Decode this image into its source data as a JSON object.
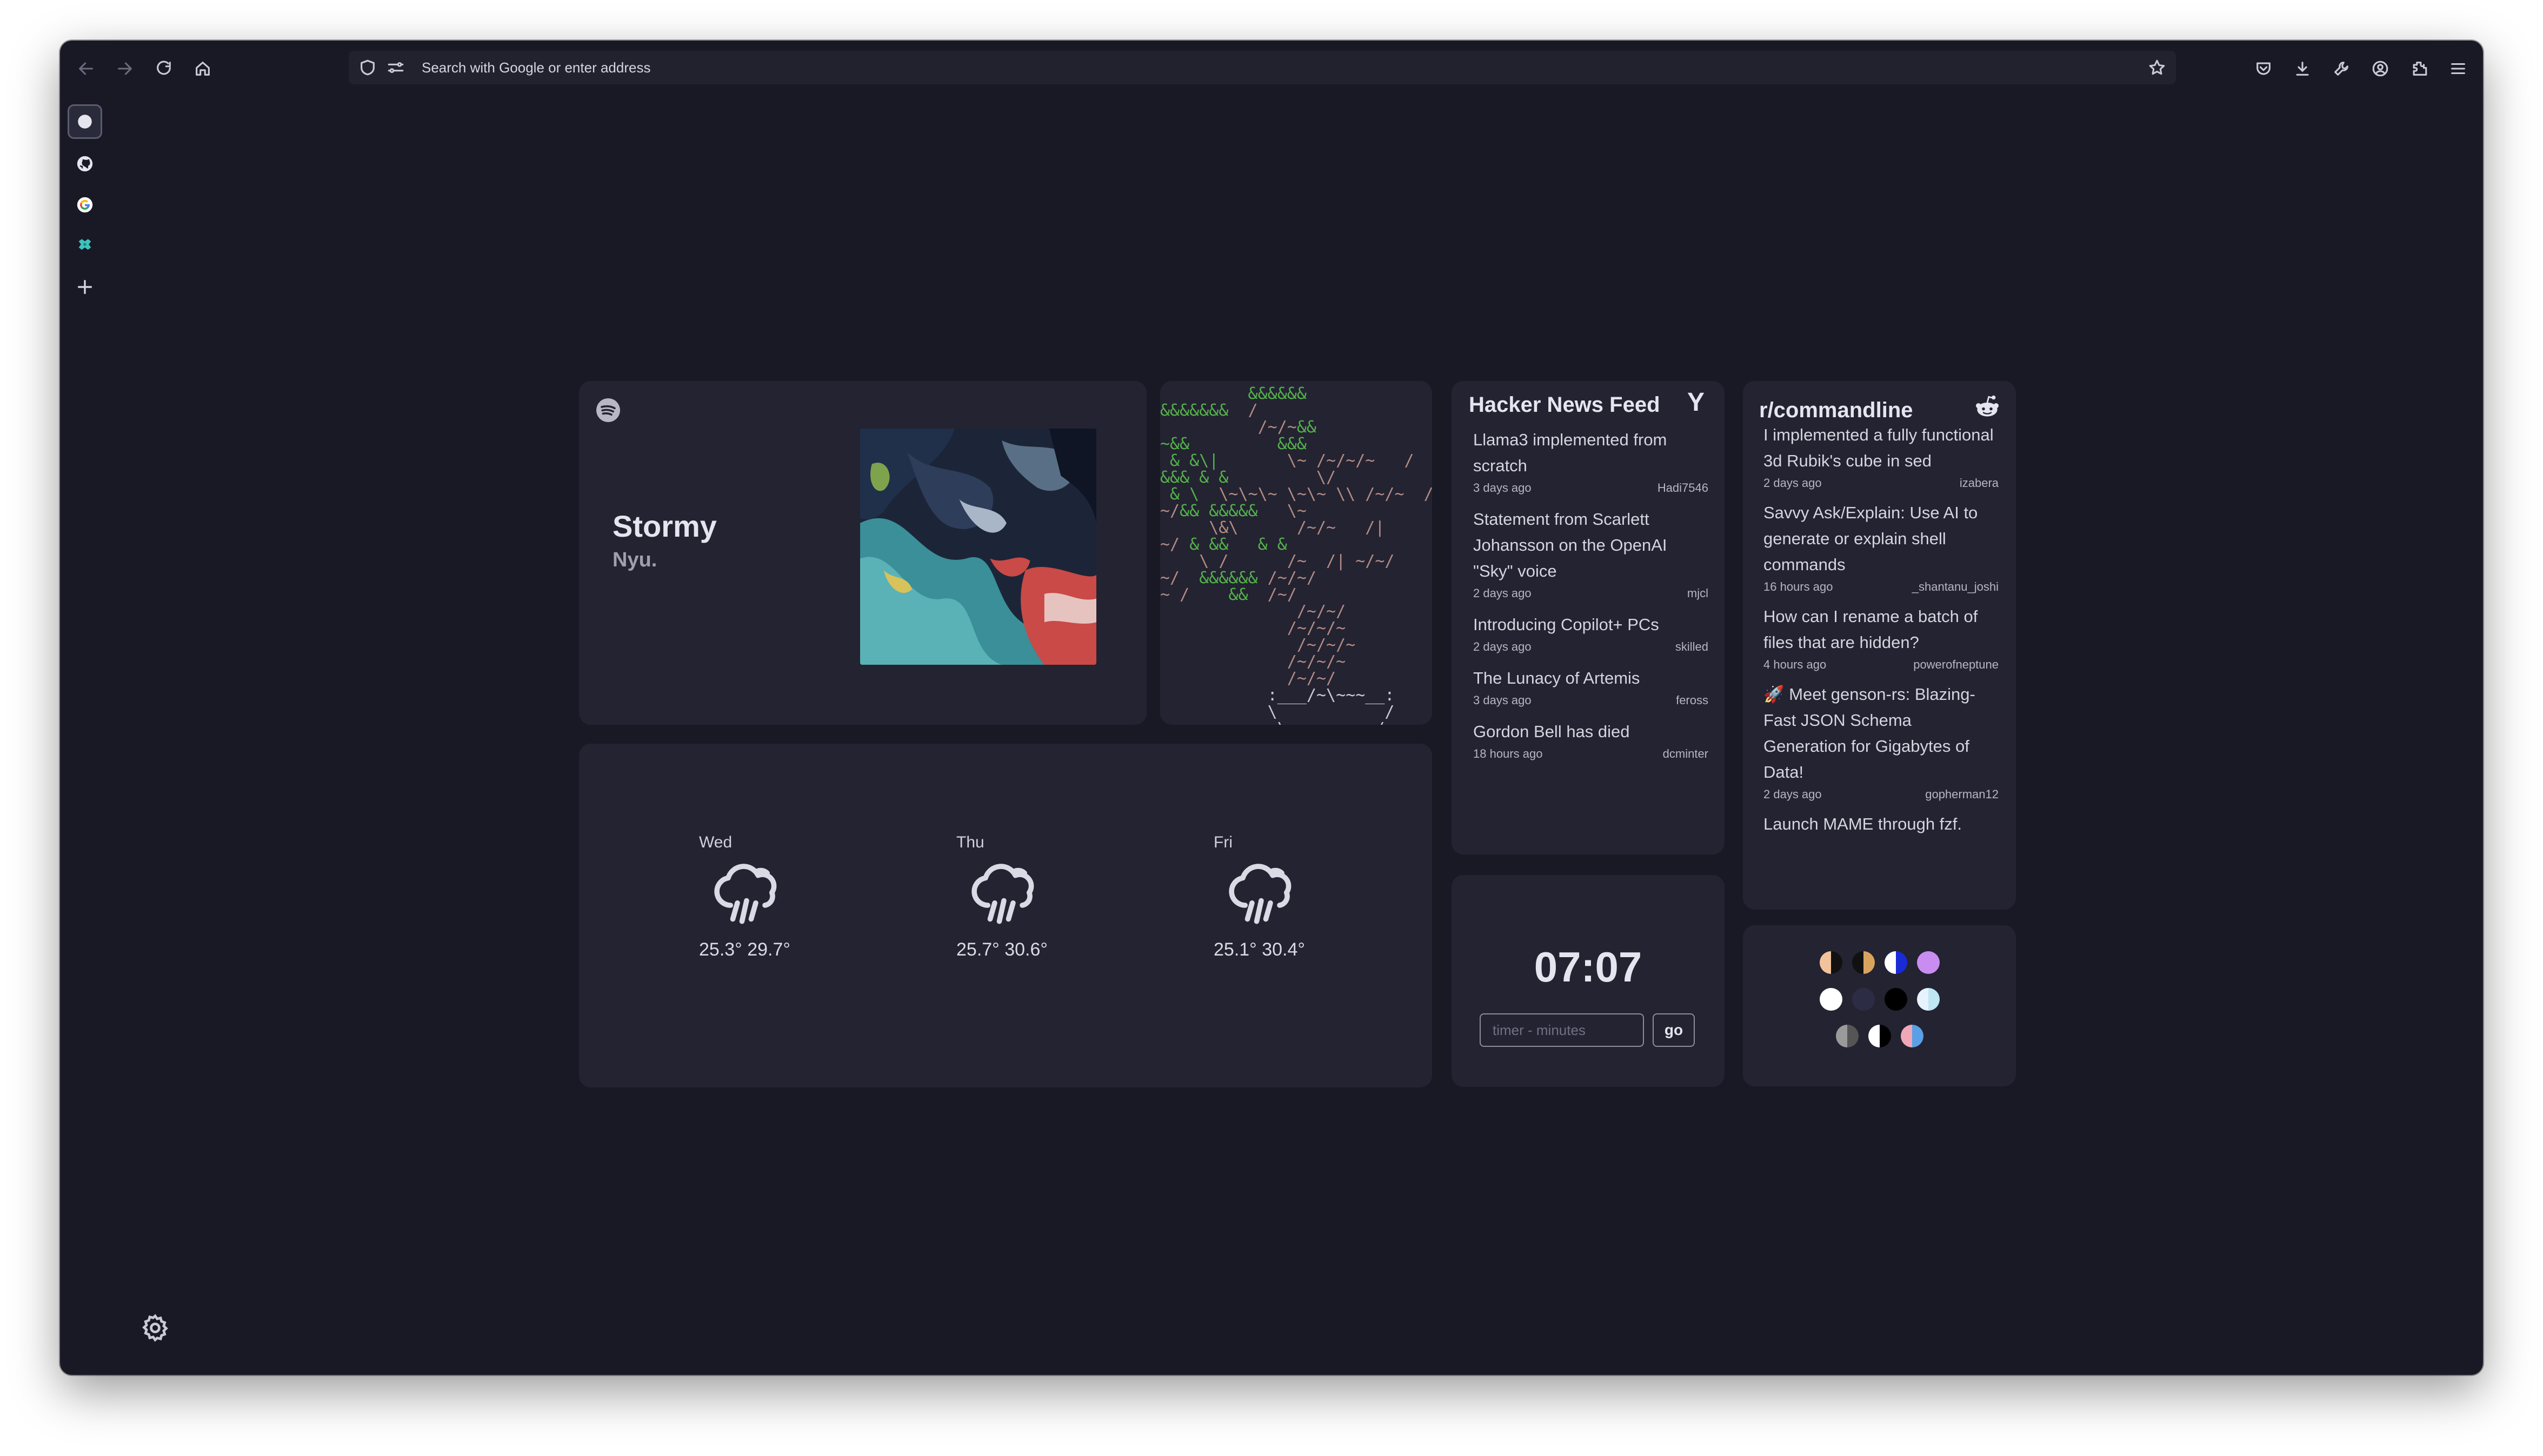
{
  "browser": {
    "url_placeholder": "Search with Google or enter address"
  },
  "sidebar": {
    "items": [
      {
        "name": "home",
        "icon": "circle-icon",
        "active": true
      },
      {
        "name": "github",
        "icon": "github-icon"
      },
      {
        "name": "google",
        "icon": "google-icon"
      },
      {
        "name": "extension",
        "icon": "puzzle-icon"
      }
    ],
    "add_icon": "plus-icon"
  },
  "spotify": {
    "title": "Stormy",
    "artist": "Nyu."
  },
  "weather": {
    "days": [
      {
        "day": "Wed",
        "low": "25.3°",
        "high": "29.7°",
        "icon": "rain-icon"
      },
      {
        "day": "Thu",
        "low": "25.7°",
        "high": "30.6°",
        "icon": "rain-icon"
      },
      {
        "day": "Fri",
        "low": "25.1°",
        "high": "30.4°",
        "icon": "rain-icon"
      }
    ]
  },
  "hacker_news": {
    "title": "Hacker News Feed",
    "logo": "Y",
    "items": [
      {
        "title": "Llama3 implemented from scratch",
        "time": "3 days ago",
        "author": "Hadi7546"
      },
      {
        "title": "Statement from Scarlett Johansson on the OpenAI \"Sky\" voice",
        "time": "2 days ago",
        "author": "mjcl"
      },
      {
        "title": "Introducing Copilot+ PCs",
        "time": "2 days ago",
        "author": "skilled"
      },
      {
        "title": "The Lunacy of Artemis",
        "time": "3 days ago",
        "author": "feross"
      },
      {
        "title": "Gordon Bell has died",
        "time": "18 hours ago",
        "author": "dcminter"
      }
    ]
  },
  "timer": {
    "clock": "07:07",
    "placeholder": "timer - minutes",
    "button": "go"
  },
  "reddit": {
    "title": "r/commandline",
    "items": [
      {
        "title": "I implemented a fully functional 3d Rubik's cube in sed",
        "time": "2 days ago",
        "author": "izabera"
      },
      {
        "title": "Savvy Ask/Explain: Use AI to generate or explain shell commands",
        "time": "16 hours ago",
        "author": "_shantanu_joshi"
      },
      {
        "title": "How can I rename a batch of files that are hidden?",
        "time": "4 hours ago",
        "author": "powerofneptune"
      },
      {
        "title": "🚀 Meet genson-rs: Blazing-Fast JSON Schema Generation for Gigabytes of Data!",
        "time": "2 days ago",
        "author": "gopherman12"
      },
      {
        "title": "Launch MAME through fzf.",
        "time": "",
        "author": ""
      }
    ]
  },
  "theme_swatches": [
    [
      "#f2c39b",
      "#111111"
    ],
    [
      "#111111",
      "#d9a35f"
    ],
    [
      "#ffffff",
      "#1a2bd6"
    ],
    [
      "#c98cf0",
      "#c98cf0"
    ],
    [
      "#ffffff",
      "#ffffff"
    ],
    [
      "#2c2c44",
      "#2c2c44"
    ],
    [
      "#000000",
      "#000000"
    ],
    [
      "#e7f2ff",
      "#bfe6f2"
    ],
    [
      "#9a9a9a",
      "#555555"
    ],
    [
      "#ffffff",
      "#000000"
    ],
    [
      "#f0a7b8",
      "#5aa0e6"
    ]
  ]
}
